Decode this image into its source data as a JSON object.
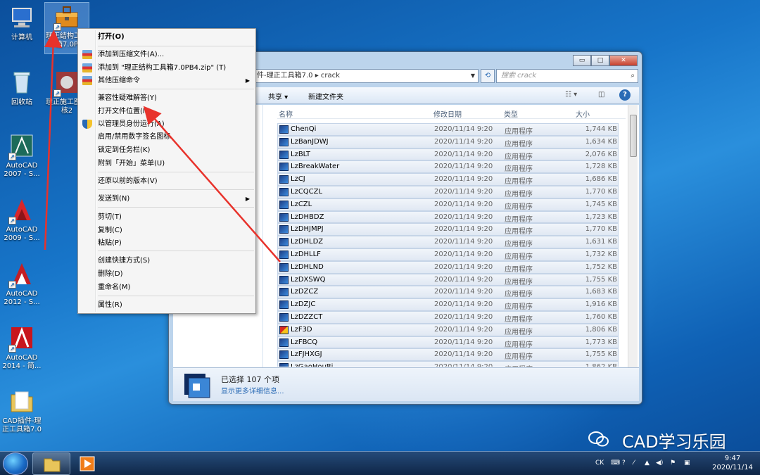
{
  "desktop": {
    "icons": [
      {
        "label": "计算机",
        "icon": "computer-icon"
      },
      {
        "label": "理正结构工具箱7.0P",
        "icon": "toolbox-icon"
      },
      {
        "label": "回收站",
        "icon": "recycle-bin-icon"
      },
      {
        "label": "理正施工图审核2",
        "icon": "review-app-icon"
      },
      {
        "label": "AutoCAD 2007 - S...",
        "icon": "autocad-2007-icon"
      },
      {
        "label": "AutoCAD 2009 - S...",
        "icon": "autocad-2009-icon"
      },
      {
        "label": "AutoCAD 2012 - S...",
        "icon": "autocad-2012-icon"
      },
      {
        "label": "AutoCAD 2014 - 简...",
        "icon": "autocad-2014-icon"
      },
      {
        "label": "CAD插件-理正工具箱7.0",
        "icon": "folder-icon"
      }
    ]
  },
  "context_menu": {
    "items": [
      {
        "label": "打开(O)",
        "bold": true
      },
      {
        "label": "添加到压缩文件(A)..."
      },
      {
        "label": "添加到 \"理正结构工具箱7.0PB4.zip\" (T)"
      },
      {
        "label": "其他压缩命令",
        "submenu": "▶"
      },
      {
        "label": "兼容性疑难解答(Y)"
      },
      {
        "label": "打开文件位置(I)"
      },
      {
        "label": "以管理员身份运行(A)"
      },
      {
        "label": "启用/禁用数字签名图标"
      },
      {
        "label": "锁定到任务栏(K)"
      },
      {
        "label": "附到「开始」菜单(U)"
      },
      {
        "label": "还原以前的版本(V)"
      },
      {
        "label": "发送到(N)",
        "submenu": "▶"
      },
      {
        "label": "剪切(T)"
      },
      {
        "label": "复制(C)"
      },
      {
        "label": "粘贴(P)"
      },
      {
        "label": "创建快捷方式(S)"
      },
      {
        "label": "删除(D)"
      },
      {
        "label": "重命名(M)"
      },
      {
        "label": "属性(R)"
      }
    ]
  },
  "explorer": {
    "window_buttons": {
      "minimize": "▭",
      "maximize": "□",
      "close": "✕"
    },
    "address": "件-理正工具箱7.0  ▸  crack",
    "search_placeholder": "搜索 crack",
    "toolbar": {
      "share": "共享 ▾",
      "new_folder": "新建文件夹"
    },
    "columns": {
      "name": "名称",
      "date": "修改日期",
      "type": "类型",
      "size": "大小"
    },
    "files": [
      {
        "name": "ChenQi",
        "date": "2020/11/14 9:20",
        "type": "应用程序",
        "size": "1,744 KB"
      },
      {
        "name": "LzBanJDWJ",
        "date": "2020/11/14 9:20",
        "type": "应用程序",
        "size": "1,634 KB"
      },
      {
        "name": "LzBLT",
        "date": "2020/11/14 9:20",
        "type": "应用程序",
        "size": "2,076 KB"
      },
      {
        "name": "LzBreakWater",
        "date": "2020/11/14 9:20",
        "type": "应用程序",
        "size": "1,728 KB"
      },
      {
        "name": "LzCJ",
        "date": "2020/11/14 9:20",
        "type": "应用程序",
        "size": "1,686 KB"
      },
      {
        "name": "LzCQCZL",
        "date": "2020/11/14 9:20",
        "type": "应用程序",
        "size": "1,770 KB"
      },
      {
        "name": "LzCZL",
        "date": "2020/11/14 9:20",
        "type": "应用程序",
        "size": "1,745 KB"
      },
      {
        "name": "LzDHBDZ",
        "date": "2020/11/14 9:20",
        "type": "应用程序",
        "size": "1,723 KB"
      },
      {
        "name": "LzDHJMPJ",
        "date": "2020/11/14 9:20",
        "type": "应用程序",
        "size": "1,770 KB"
      },
      {
        "name": "LzDHLDZ",
        "date": "2020/11/14 9:20",
        "type": "应用程序",
        "size": "1,631 KB"
      },
      {
        "name": "LzDHLLF",
        "date": "2020/11/14 9:20",
        "type": "应用程序",
        "size": "1,732 KB"
      },
      {
        "name": "LzDHLND",
        "date": "2020/11/14 9:20",
        "type": "应用程序",
        "size": "1,752 KB"
      },
      {
        "name": "LzDXSWQ",
        "date": "2020/11/14 9:20",
        "type": "应用程序",
        "size": "1,755 KB"
      },
      {
        "name": "LzDZCZ",
        "date": "2020/11/14 9:20",
        "type": "应用程序",
        "size": "1,683 KB"
      },
      {
        "name": "LzDZJC",
        "date": "2020/11/14 9:20",
        "type": "应用程序",
        "size": "1,916 KB"
      },
      {
        "name": "LzDZZCT",
        "date": "2020/11/14 9:20",
        "type": "应用程序",
        "size": "1,760 KB"
      },
      {
        "name": "LzF3D",
        "date": "2020/11/14 9:20",
        "type": "应用程序",
        "size": "1,806 KB"
      },
      {
        "name": "LzFBCQ",
        "date": "2020/11/14 9:20",
        "type": "应用程序",
        "size": "1,773 KB"
      },
      {
        "name": "LzFJHXGJ",
        "date": "2020/11/14 9:20",
        "type": "应用程序",
        "size": "1,755 KB"
      },
      {
        "name": "LzGaoHouBi",
        "date": "2020/11/14 9:20",
        "type": "应用程序",
        "size": "1,862 KB"
      }
    ],
    "status_selected": "已选择 107 个项",
    "status_more": "显示更多详细信息..."
  },
  "taskbar": {
    "tray_lang": "CK",
    "time": "9:47",
    "date": "2020/11/14"
  },
  "watermark": "CAD学习乐园",
  "colors": {
    "arrow": "#e8322b",
    "selection": "#cfe0f3",
    "link": "#2a6bb5"
  }
}
